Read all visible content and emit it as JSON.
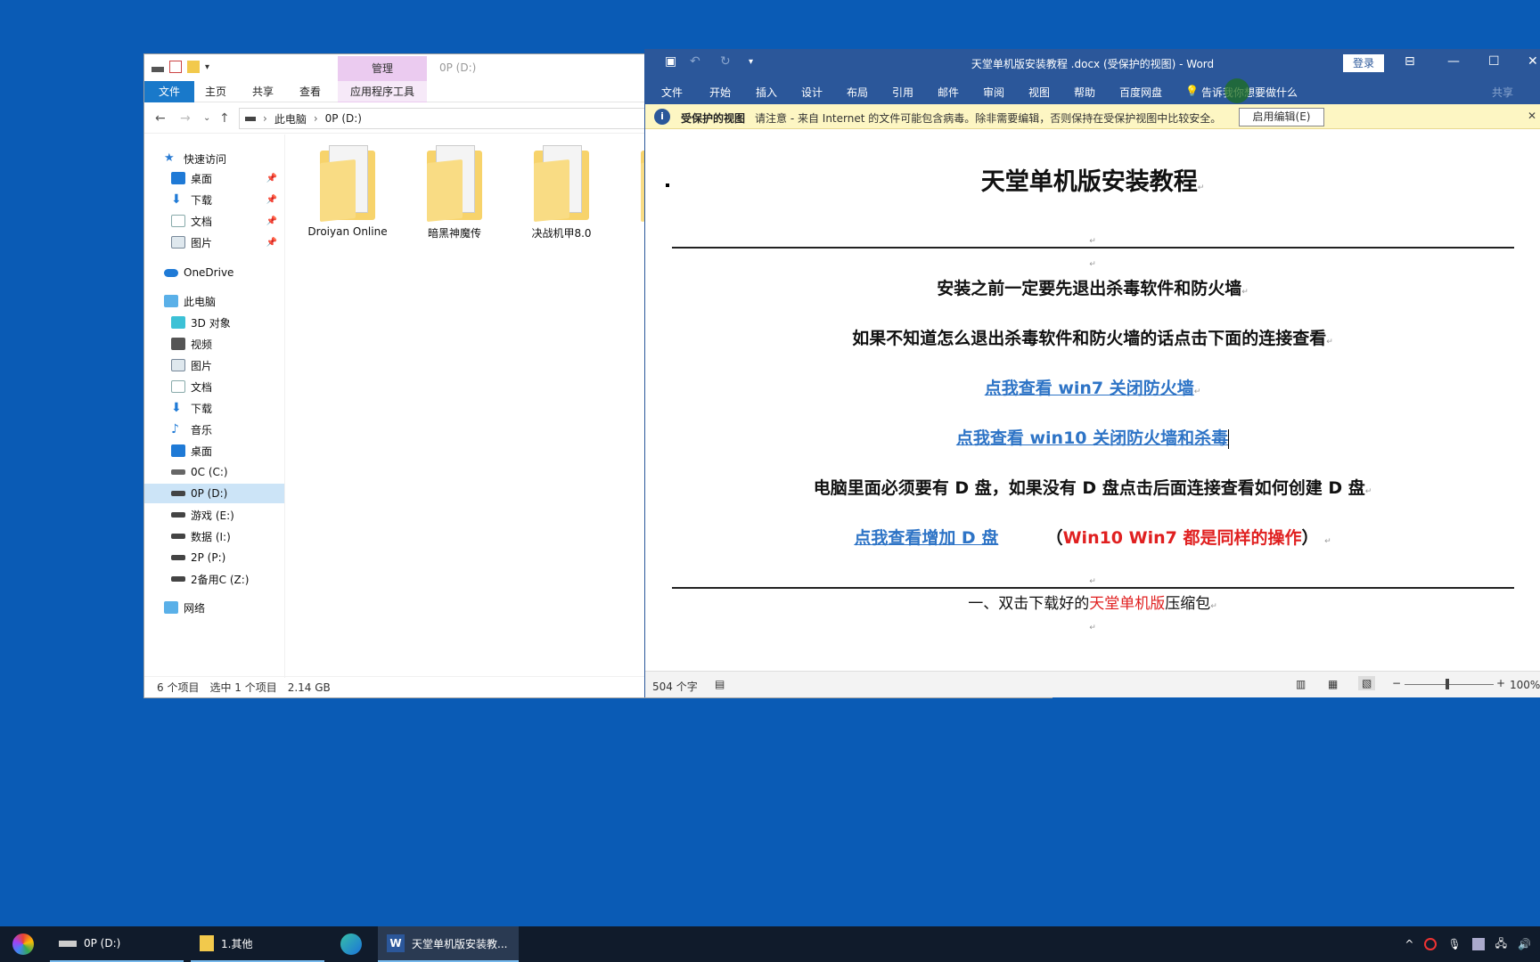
{
  "explorer": {
    "context_tab_top": "管理",
    "title": "0P (D:)",
    "tabs": [
      "文件",
      "主页",
      "共享",
      "查看"
    ],
    "context_tab": "应用程序工具",
    "breadcrumb": [
      "此电脑",
      "0P (D:)"
    ],
    "nav": {
      "quick_access": "快速访问",
      "desktop_pinned": "桌面",
      "downloads_pinned": "下载",
      "documents_pinned": "文档",
      "pictures_pinned": "图片",
      "onedrive": "OneDrive",
      "this_pc": "此电脑",
      "objects3d": "3D 对象",
      "videos": "视频",
      "pictures": "图片",
      "documents": "文档",
      "downloads": "下载",
      "music": "音乐",
      "desktop": "桌面",
      "drive_c": "0C (C:)",
      "drive_d": "0P (D:)",
      "drive_e": "游戏 (E:)",
      "drive_i": "数据 (I:)",
      "drive_p": "2P (P:)",
      "drive_z": "2备用C (Z:)",
      "network": "网络"
    },
    "folders": [
      "Droiyan Online",
      "暗黑神魔传",
      "决战机甲8.0",
      "天"
    ],
    "status": {
      "count": "6 个项目",
      "selected": "选中 1 个项目",
      "size": "2.14 GB"
    }
  },
  "word": {
    "title": "天堂单机版安装教程 .docx (受保护的视图)  -  Word",
    "login": "登录",
    "tabs": [
      "文件",
      "开始",
      "插入",
      "设计",
      "布局",
      "引用",
      "邮件",
      "审阅",
      "视图",
      "帮助",
      "百度网盘"
    ],
    "tell_me": "告诉我你想要做什么",
    "share": "共享",
    "protect": {
      "title": "受保护的视图",
      "message": "请注意 - 来自 Internet 的文件可能包含病毒。除非需要编辑，否则保持在受保护视图中比较安全。",
      "enable_button": "启用编辑(E)"
    },
    "doc": {
      "title": "天堂单机版安装教程",
      "line1": "安装之前一定要先退出杀毒软件和防火墙",
      "line2": "如果不知道怎么退出杀毒软件和防火墙的话点击下面的连接查看",
      "link_win7": "点我查看 win7 关闭防火墙",
      "link_win10": "点我查看 win10 关闭防火墙和杀毒",
      "line3": "电脑里面必须要有 D 盘，如果没有 D 盘点击后面连接查看如何创建 D 盘",
      "link_dpan": "点我查看增加 D 盘",
      "note_open": "（",
      "note_red": "Win10 Win7  都是同样的操作",
      "note_close": "）",
      "step1_prefix": "一、双击下载好的",
      "step1_red": "天堂单机版",
      "step1_suffix": "压缩包",
      "para_mark": "↵"
    },
    "status": {
      "word_count": "504 个字",
      "zoom": "100%"
    }
  },
  "taskbar": {
    "item1": "0P (D:)",
    "item2": "1.其他",
    "item4": "天堂单机版安装教..."
  },
  "colors": {
    "desktop": "#0a5bb5",
    "word_blue": "#2b579a",
    "link_blue": "#2e74c6",
    "red_text": "#e02020"
  }
}
